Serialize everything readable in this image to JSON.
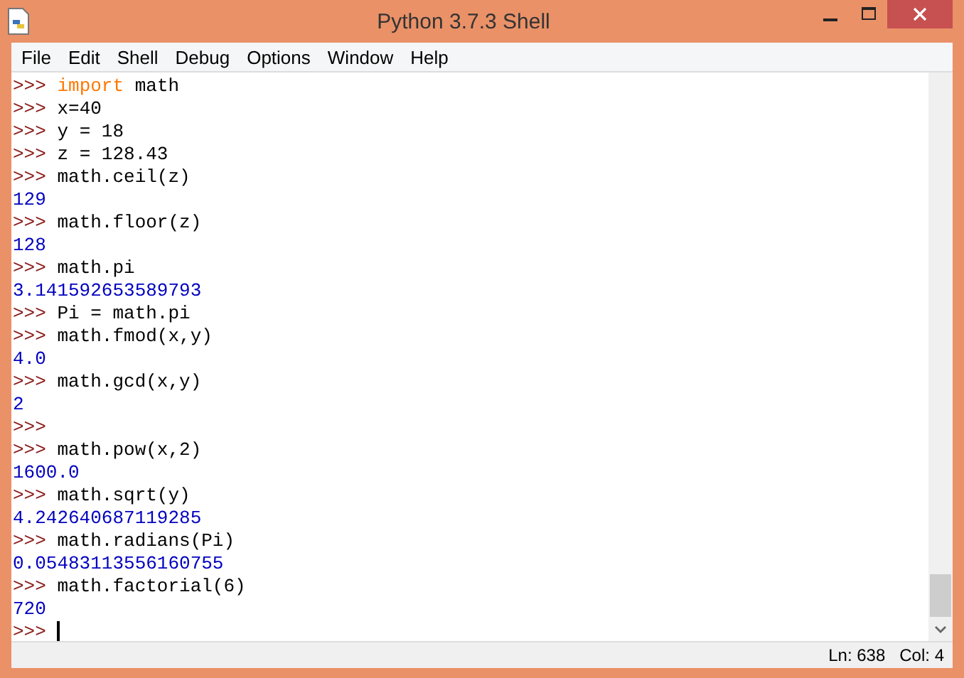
{
  "window": {
    "title": "Python 3.7.3 Shell"
  },
  "menu": [
    {
      "label": "File"
    },
    {
      "label": "Edit"
    },
    {
      "label": "Shell"
    },
    {
      "label": "Debug"
    },
    {
      "label": "Options"
    },
    {
      "label": "Window"
    },
    {
      "label": "Help"
    }
  ],
  "lines": [
    {
      "kind": "input",
      "prompt": ">>>",
      "keyword": "import",
      "code": "math"
    },
    {
      "kind": "input",
      "prompt": ">>>",
      "code": "x=40"
    },
    {
      "kind": "input",
      "prompt": ">>>",
      "code": "y = 18"
    },
    {
      "kind": "input",
      "prompt": ">>>",
      "code": "z = 128.43"
    },
    {
      "kind": "input",
      "prompt": ">>>",
      "code": "math.ceil(z)"
    },
    {
      "kind": "output",
      "text": "129"
    },
    {
      "kind": "input",
      "prompt": ">>>",
      "code": "math.floor(z)"
    },
    {
      "kind": "output",
      "text": "128"
    },
    {
      "kind": "input",
      "prompt": ">>>",
      "code": "math.pi"
    },
    {
      "kind": "output",
      "text": "3.141592653589793"
    },
    {
      "kind": "input",
      "prompt": ">>>",
      "code": "Pi = math.pi"
    },
    {
      "kind": "input",
      "prompt": ">>>",
      "code": "math.fmod(x,y)"
    },
    {
      "kind": "output",
      "text": "4.0"
    },
    {
      "kind": "input",
      "prompt": ">>>",
      "code": "math.gcd(x,y)"
    },
    {
      "kind": "output",
      "text": "2"
    },
    {
      "kind": "input",
      "prompt": ">>>"
    },
    {
      "kind": "input",
      "prompt": ">>>",
      "code": "math.pow(x,2)"
    },
    {
      "kind": "output",
      "text": "1600.0"
    },
    {
      "kind": "input",
      "prompt": ">>>",
      "code": "math.sqrt(y)"
    },
    {
      "kind": "output",
      "text": "4.242640687119285"
    },
    {
      "kind": "input",
      "prompt": ">>>",
      "code": "math.radians(Pi)"
    },
    {
      "kind": "output",
      "text": "0.05483113556160755"
    },
    {
      "kind": "input",
      "prompt": ">>>",
      "code": "math.factorial(6)"
    },
    {
      "kind": "output",
      "text": "720"
    },
    {
      "kind": "input",
      "prompt": ">>>",
      "cursor": true
    }
  ],
  "status_bar": {
    "line": "Ln: 638",
    "column": "Col: 4"
  }
}
